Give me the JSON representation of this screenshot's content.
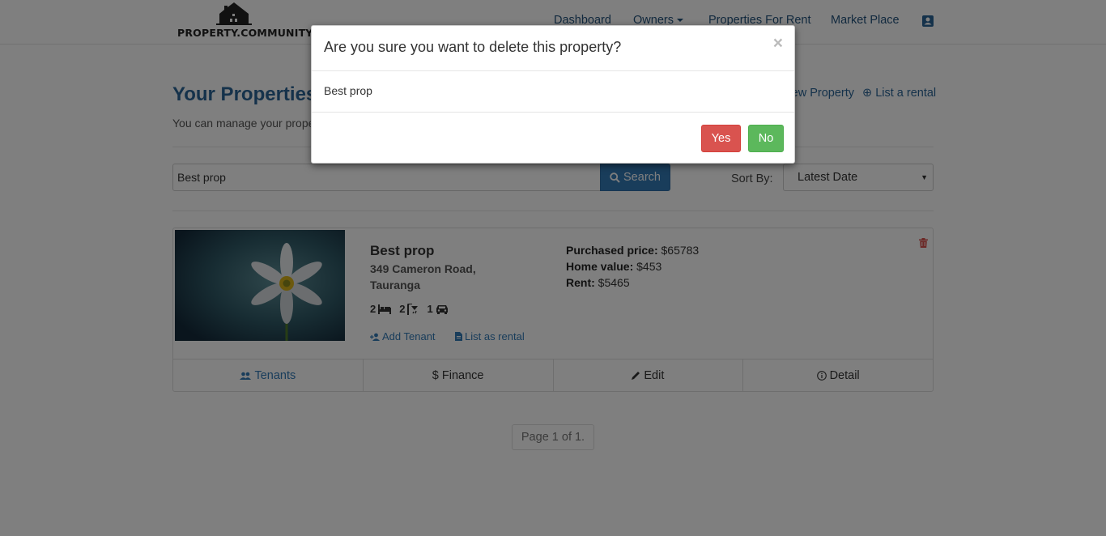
{
  "brand": {
    "name": "PROPERTY.COMMUNITY"
  },
  "nav": {
    "dashboard": "Dashboard",
    "owners": "Owners",
    "properties_for_rent": "Properties For Rent",
    "market_place": "Market Place",
    "profile_icon": "contact-card-icon"
  },
  "header": {
    "title": "Your Properties",
    "subtitle": "You can manage your properties",
    "new_property": "New Property",
    "list_rental": "List a rental"
  },
  "search": {
    "value": "Best prop",
    "button": "Search",
    "sort_label": "Sort By:",
    "sort_value": "Latest Date"
  },
  "property": {
    "name": "Best prop",
    "address": "349 Cameron Road, Tauranga",
    "bedrooms": "2",
    "bathrooms": "2",
    "parking": "1",
    "add_tenant": "Add Tenant",
    "list_as_rental": "List as rental",
    "purchased_label": "Purchased price:",
    "purchased_value": "$65783",
    "home_value_label": "Home value:",
    "home_value_value": "$453",
    "rent_label": "Rent:",
    "rent_value": "$5465",
    "footer": {
      "tenants": "Tenants",
      "finance": "Finance",
      "edit": "Edit",
      "detail": "Detail"
    }
  },
  "pagination": {
    "text": "Page 1 of 1."
  },
  "modal": {
    "title": "Are you sure you want to delete this property?",
    "close": "×",
    "body": "Best prop",
    "yes": "Yes",
    "no": "No"
  },
  "colors": {
    "link": "#337ab7",
    "danger": "#d9534f",
    "success": "#5cb85c",
    "title": "#2a6496"
  }
}
